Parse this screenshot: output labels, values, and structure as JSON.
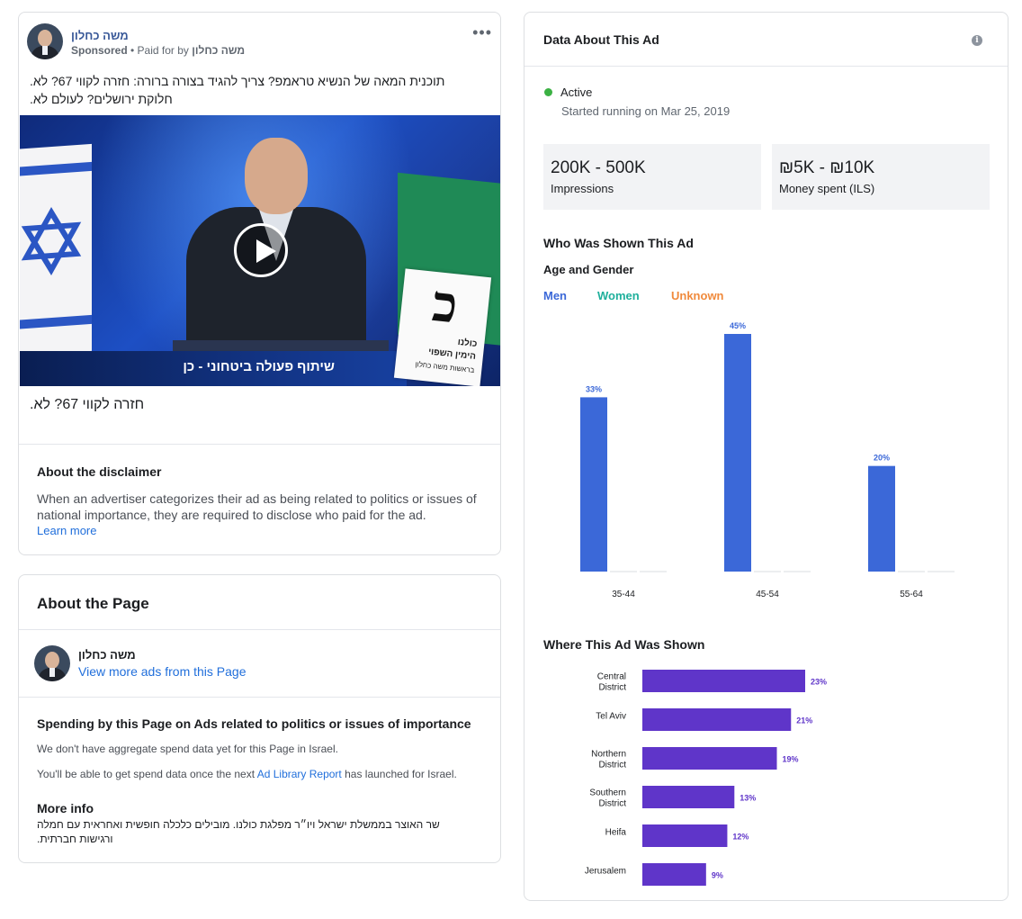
{
  "ad": {
    "page_name": "משה כחלון",
    "sponsored_label": "Sponsored",
    "paid_for_prefix": "• Paid for by",
    "paid_for_name": "משה כחלון",
    "more_icon": "ellipsis-icon",
    "body_line1": "תוכנית המאה של הנשיא טראמפ? צריך להגיד בצורה ברורה: חזרה לקווי 67? לא.",
    "body_line2": "חלוקת ירושלים? לעולם לא.",
    "video": {
      "lower_third": "שיתוף פעולה ביטחוני - כן",
      "sign_letter": "כ",
      "sign_line1": "כולנו",
      "sign_line2": "הימין השפוי",
      "sign_line3": "בראשות משה כחלון"
    },
    "caption": "חזרה לקווי 67? לא.",
    "disclaimer_title": "About the disclaimer",
    "disclaimer_text": "When an advertiser categorizes their ad as being related to politics or issues of national importance, they are required to disclose who paid for the ad.",
    "learn_more": "Learn more"
  },
  "page": {
    "title": "About the Page",
    "name": "משה כחלון",
    "view_more": "View more ads from this Page",
    "spending_title": "Spending by this Page on Ads related to politics or issues of importance",
    "spending_line1": "We don't have aggregate spend data yet for this Page in Israel.",
    "spending_line2_a": "You'll be able to get spend data once the next",
    "spending_line2_link": "Ad Library Report",
    "spending_line2_b": "has launched for Israel.",
    "more_info_title": "More info",
    "more_info_line1": "שר האוצר בממשלת ישראל ויו״ר מפלגת כולנו. מובילים כלכלה חופשית ואחראית עם חמלה",
    "more_info_line2": "ורגישות חברתית."
  },
  "data": {
    "title": "Data About This Ad",
    "info_icon": "info-icon",
    "status": "Active",
    "started": "Started running on Mar 25, 2019",
    "impressions_value": "200K - 500K",
    "impressions_label": "Impressions",
    "spent_value": "₪5K - ₪10K",
    "spent_label": "Money spent (ILS)",
    "who_title": "Who Was Shown This Ad",
    "age_gender_title": "Age and Gender",
    "legend": {
      "men": "Men",
      "women": "Women",
      "unknown": "Unknown"
    },
    "where_title": "Where This Ad Was Shown",
    "colors": {
      "men": "#3b68d8",
      "women": "#1fb09c",
      "unknown": "#f08a3c",
      "region": "#5f35c9",
      "active": "#3bb143"
    }
  },
  "chart_data": [
    {
      "type": "bar",
      "title": "Age and Gender",
      "categories": [
        "35-44",
        "45-54",
        "55-64"
      ],
      "series": [
        {
          "name": "Men",
          "values": [
            33,
            45,
            20
          ]
        },
        {
          "name": "Women",
          "values": [
            0,
            0,
            0
          ]
        },
        {
          "name": "Unknown",
          "values": [
            0,
            0,
            0
          ]
        }
      ],
      "data_labels": [
        "33%",
        "45%",
        "20%"
      ],
      "ylim": [
        0,
        45
      ]
    },
    {
      "type": "bar",
      "orientation": "horizontal",
      "title": "Where This Ad Was Shown",
      "categories": [
        "Central District",
        "Tel Aviv",
        "Northern District",
        "Southern District",
        "Heifa",
        "Jerusalem"
      ],
      "values": [
        23,
        21,
        19,
        13,
        12,
        9
      ],
      "data_labels": [
        "23%",
        "21%",
        "19%",
        "13%",
        "12%",
        "9%"
      ],
      "xlim": [
        0,
        23
      ]
    }
  ]
}
